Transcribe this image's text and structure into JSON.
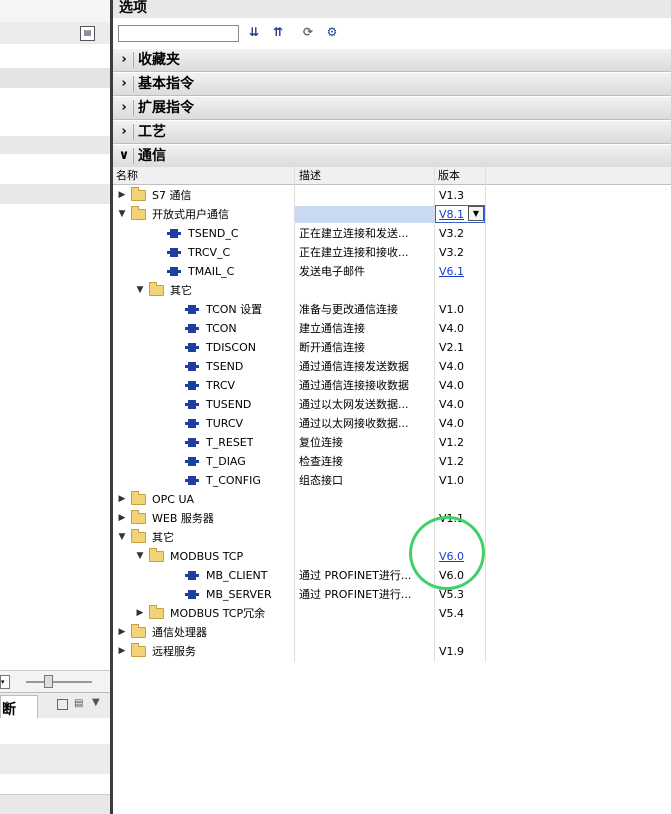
{
  "right_panel": {
    "title": "选项",
    "search": {
      "value": "",
      "placeholder": ""
    },
    "sections": [
      {
        "label": "收藏夹",
        "expanded": false
      },
      {
        "label": "基本指令",
        "expanded": false
      },
      {
        "label": "扩展指令",
        "expanded": false
      },
      {
        "label": "工艺",
        "expanded": false
      },
      {
        "label": "通信",
        "expanded": true
      }
    ],
    "columns": {
      "name": "名称",
      "description": "描述",
      "version": "版本"
    },
    "rows": [
      {
        "level": 0,
        "type": "folder",
        "expander": "▶",
        "name": "S7 通信",
        "description": "",
        "version": "V1.3",
        "version_link": false
      },
      {
        "level": 0,
        "type": "folder",
        "expander": "▼",
        "name": "开放式用户通信",
        "description": "",
        "version": "V8.1",
        "version_link": true,
        "selected": true
      },
      {
        "level": 1,
        "type": "block",
        "expander": "",
        "name": "TSEND_C",
        "description": "正在建立连接和发送...",
        "version": "V3.2",
        "version_link": false
      },
      {
        "level": 1,
        "type": "block",
        "expander": "",
        "name": "TRCV_C",
        "description": "正在建立连接和接收...",
        "version": "V3.2",
        "version_link": false
      },
      {
        "level": 1,
        "type": "block",
        "expander": "",
        "name": "TMAIL_C",
        "description": "发送电子邮件",
        "version": "V6.1",
        "version_link": true
      },
      {
        "level": 1,
        "type": "folder",
        "expander": "▼",
        "name": "其它",
        "description": "",
        "version": "",
        "version_link": false
      },
      {
        "level": 2,
        "type": "block",
        "expander": "",
        "name": "TCON 设置",
        "description": "准备与更改通信连接",
        "version": "V1.0",
        "version_link": false
      },
      {
        "level": 2,
        "type": "block",
        "expander": "",
        "name": "TCON",
        "description": "建立通信连接",
        "version": "V4.0",
        "version_link": false
      },
      {
        "level": 2,
        "type": "block",
        "expander": "",
        "name": "TDISCON",
        "description": "断开通信连接",
        "version": "V2.1",
        "version_link": false
      },
      {
        "level": 2,
        "type": "block",
        "expander": "",
        "name": "TSEND",
        "description": "通过通信连接发送数据",
        "version": "V4.0",
        "version_link": false
      },
      {
        "level": 2,
        "type": "block",
        "expander": "",
        "name": "TRCV",
        "description": "通过通信连接接收数据",
        "version": "V4.0",
        "version_link": false
      },
      {
        "level": 2,
        "type": "block",
        "expander": "",
        "name": "TUSEND",
        "description": "通过以太网发送数据...",
        "version": "V4.0",
        "version_link": false
      },
      {
        "level": 2,
        "type": "block",
        "expander": "",
        "name": "TURCV",
        "description": "通过以太网接收数据...",
        "version": "V4.0",
        "version_link": false
      },
      {
        "level": 2,
        "type": "block",
        "expander": "",
        "name": "T_RESET",
        "description": "复位连接",
        "version": "V1.2",
        "version_link": false
      },
      {
        "level": 2,
        "type": "block",
        "expander": "",
        "name": "T_DIAG",
        "description": "检查连接",
        "version": "V1.2",
        "version_link": false
      },
      {
        "level": 2,
        "type": "block",
        "expander": "",
        "name": "T_CONFIG",
        "description": "组态接口",
        "version": "V1.0",
        "version_link": false
      },
      {
        "level": 0,
        "type": "folder",
        "expander": "▶",
        "name": "OPC UA",
        "description": "",
        "version": "",
        "version_link": false
      },
      {
        "level": 0,
        "type": "folder",
        "expander": "▶",
        "name": "WEB 服务器",
        "description": "",
        "version": "V1.1",
        "version_link": false
      },
      {
        "level": 0,
        "type": "folder",
        "expander": "▼",
        "name": "其它",
        "description": "",
        "version": "",
        "version_link": false
      },
      {
        "level": 1,
        "type": "folder",
        "expander": "▼",
        "name": "MODBUS TCP",
        "description": "",
        "version": "V6.0",
        "version_link": true
      },
      {
        "level": 2,
        "type": "block",
        "expander": "",
        "name": "MB_CLIENT",
        "description": "通过 PROFINET进行...",
        "version": "V6.0",
        "version_link": false
      },
      {
        "level": 2,
        "type": "block",
        "expander": "",
        "name": "MB_SERVER",
        "description": "通过 PROFINET进行...",
        "version": "V5.3",
        "version_link": false
      },
      {
        "level": 1,
        "type": "folder",
        "expander": "▶",
        "name": "MODBUS TCP冗余",
        "description": "",
        "version": "V5.4",
        "version_link": false
      },
      {
        "level": 0,
        "type": "folder",
        "expander": "▶",
        "name": "通信处理器",
        "description": "",
        "version": "",
        "version_link": false
      },
      {
        "level": 0,
        "type": "folder",
        "expander": "▶",
        "name": "远程服务",
        "description": "",
        "version": "V1.9",
        "version_link": false
      }
    ],
    "annotation_color": "#3fd06a"
  },
  "left_panel": {
    "tab_label": "断"
  }
}
